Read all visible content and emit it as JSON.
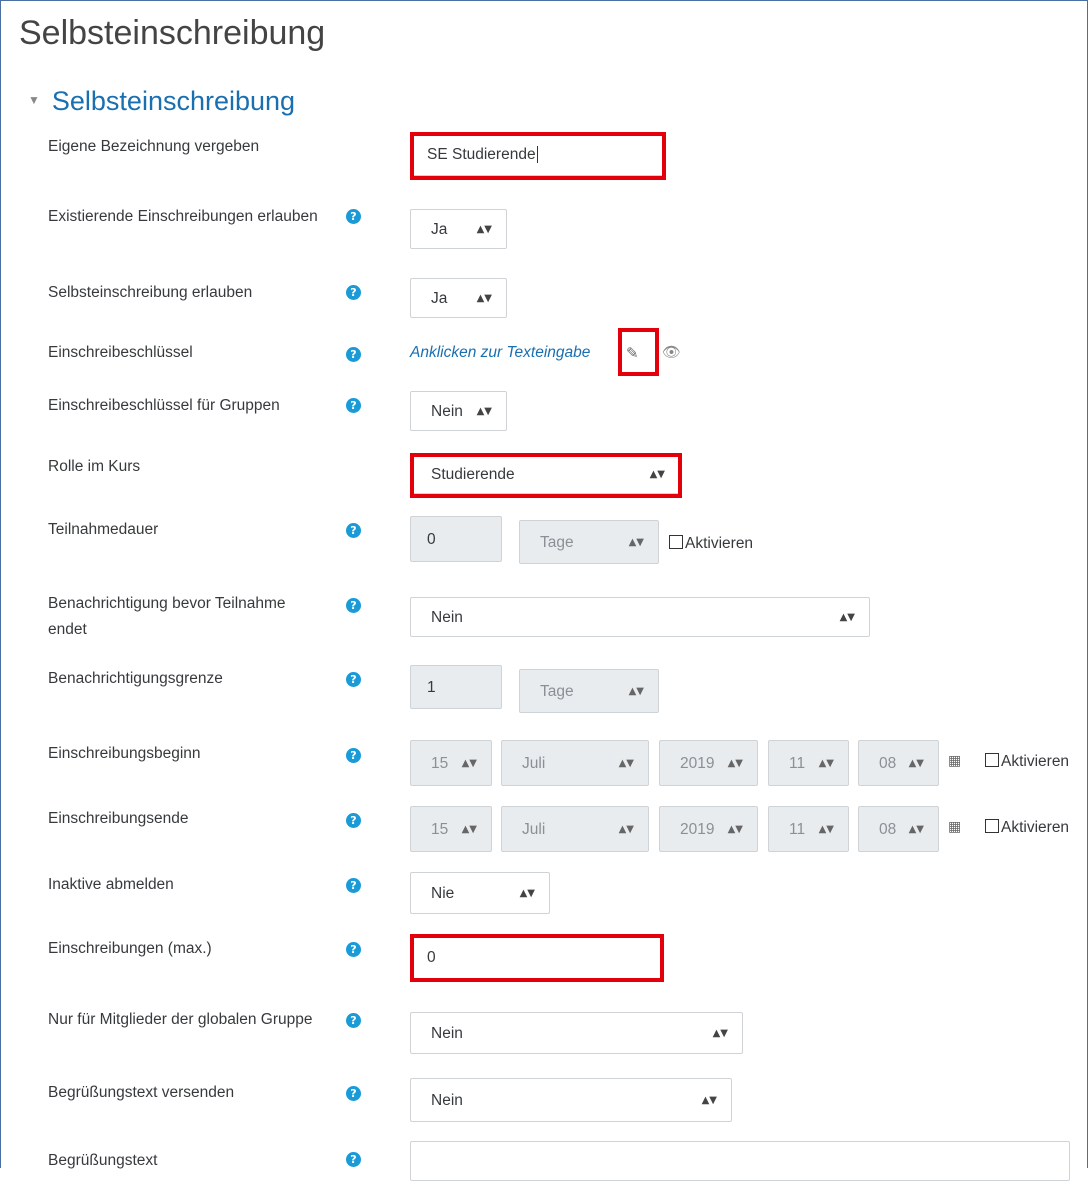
{
  "page_title": "Selbsteinschreibung",
  "section_title": "Selbsteinschreibung",
  "fields": {
    "name": {
      "label": "Eigene Bezeichnung vergeben",
      "value": "SE Studierende"
    },
    "existing": {
      "label": "Existierende Einschreibungen erlauben",
      "value": "Ja"
    },
    "allow": {
      "label": "Selbsteinschreibung erlauben",
      "value": "Ja"
    },
    "key": {
      "label": "Einschreibeschlüssel",
      "link": "Anklicken zur Texteingabe"
    },
    "groupkey": {
      "label": "Einschreibeschlüssel für Gruppen",
      "value": "Nein"
    },
    "role": {
      "label": "Rolle im Kurs",
      "value": "Studierende"
    },
    "duration": {
      "label": "Teilnahmedauer",
      "value": "0",
      "unit": "Tage",
      "enable": "Aktivieren"
    },
    "notify": {
      "label": "Benachrichtigung bevor Teilnahme endet",
      "value": "Nein"
    },
    "threshold": {
      "label": "Benachrichtigungsgrenze",
      "value": "1",
      "unit": "Tage"
    },
    "start": {
      "label": "Einschreibungsbeginn",
      "day": "15",
      "month": "Juli",
      "year": "2019",
      "hour": "11",
      "minute": "08",
      "enable": "Aktivieren"
    },
    "end": {
      "label": "Einschreibungsende",
      "day": "15",
      "month": "Juli",
      "year": "2019",
      "hour": "11",
      "minute": "08",
      "enable": "Aktivieren"
    },
    "inactive": {
      "label": "Inaktive abmelden",
      "value": "Nie"
    },
    "max": {
      "label": "Einschreibungen (max.)",
      "value": "0"
    },
    "cohort": {
      "label": "Nur für Mitglieder der globalen Gruppe",
      "value": "Nein"
    },
    "welcome": {
      "label": "Begrüßungstext versenden",
      "value": "Nein"
    },
    "welcometext": {
      "label": "Begrüßungstext",
      "value": ""
    }
  },
  "icons": {
    "help": "question-circle-icon",
    "edit": "pencil-icon",
    "reveal": "eye-icon",
    "calendar": "calendar-icon",
    "collapse": "triangle-down-icon",
    "select_arrow": "up-down-arrow-icon"
  },
  "colors": {
    "highlight": "#e3000b",
    "link": "#1a6fb0",
    "help": "#1a9bd7"
  }
}
